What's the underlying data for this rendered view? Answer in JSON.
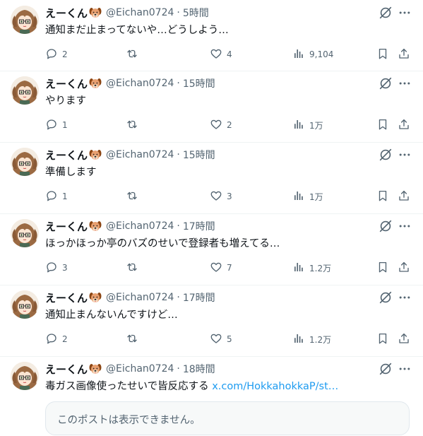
{
  "tweets": [
    {
      "name": "えーくん",
      "handle": "@Eichan0724",
      "time": "5時間",
      "text": "通知まだ止まってないや…どうしよう…",
      "replies": "2",
      "retweets": "",
      "likes": "4",
      "views": "9,104"
    },
    {
      "name": "えーくん",
      "handle": "@Eichan0724",
      "time": "15時間",
      "text": "やります",
      "replies": "1",
      "retweets": "",
      "likes": "2",
      "views": "1万"
    },
    {
      "name": "えーくん",
      "handle": "@Eichan0724",
      "time": "15時間",
      "text": "準備します",
      "replies": "1",
      "retweets": "",
      "likes": "3",
      "views": "1万"
    },
    {
      "name": "えーくん",
      "handle": "@Eichan0724",
      "time": "17時間",
      "text": "ほっかほっか亭のバズのせいで登録者も増えてる…",
      "replies": "3",
      "retweets": "",
      "likes": "7",
      "views": "1.2万"
    },
    {
      "name": "えーくん",
      "handle": "@Eichan0724",
      "time": "17時間",
      "text": "通知止まんないんですけど…",
      "replies": "2",
      "retweets": "",
      "likes": "5",
      "views": "1.2万"
    },
    {
      "name": "えーくん",
      "handle": "@Eichan0724",
      "time": "18時間",
      "text": "毒ガス画像使ったせいで皆反応する",
      "link": "x.com/HokkahokkaP/st…"
    }
  ],
  "separator": "·",
  "quote": {
    "text": "このポストは表示できません。"
  },
  "icons": [
    "avatar",
    "dog-emoji",
    "mute-icon",
    "more-icon",
    "reply-icon",
    "retweet-icon",
    "like-icon",
    "views-icon",
    "bookmark-icon",
    "share-icon"
  ],
  "colors": {
    "text": "#0f1419",
    "secondary": "#536471",
    "link": "#1d9bf0",
    "border": "#eff3f4"
  }
}
